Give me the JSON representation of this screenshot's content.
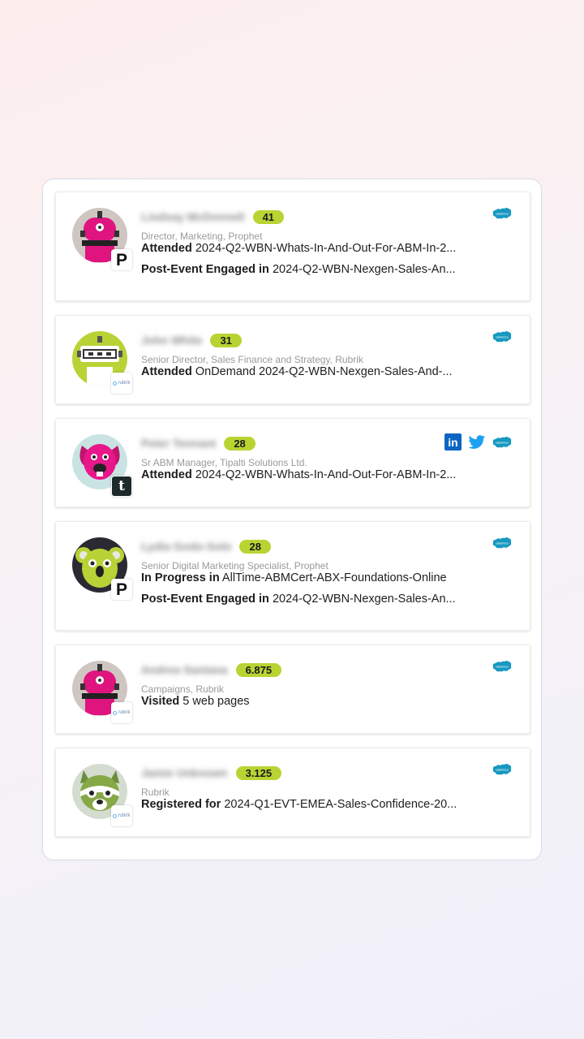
{
  "colors": {
    "score_bg": "#b8d432",
    "salesforce": "#1798c1",
    "linkedin": "#0a66c2",
    "twitter": "#1da1f2"
  },
  "contacts": [
    {
      "name": "Lindsay McDonnell",
      "score": "41",
      "title": "Director, Marketing, Prophet",
      "company_logo": "prophet-logo",
      "avatar": "pink-robot",
      "activities": [
        {
          "label": "Attended",
          "detail": " 2024-Q2-WBN-Whats-In-And-Out-For-ABM-In-2..."
        },
        {
          "label": "Post-Event Engaged in",
          "detail": " 2024-Q2-WBN-Nexgen-Sales-An..."
        }
      ],
      "icons": [
        "salesforce-icon"
      ]
    },
    {
      "name": "John White",
      "score": "31",
      "title": "Senior Director, Sales Finance and Strategy, Rubrik",
      "company_logo": "rubrik-logo",
      "avatar": "green-robot",
      "activities": [
        {
          "label": "Attended",
          "detail": " OnDemand 2024-Q2-WBN-Nexgen-Sales-And-..."
        }
      ],
      "icons": [
        "salesforce-icon"
      ]
    },
    {
      "name": "Peter Tennant",
      "score": "28",
      "title": "Sr ABM Manager, Tipalti Solutions Ltd.",
      "company_logo": "tipalti-logo",
      "avatar": "pink-dog",
      "activities": [
        {
          "label": "Attended",
          "detail": " 2024-Q2-WBN-Whats-In-And-Out-For-ABM-In-2..."
        }
      ],
      "icons": [
        "linkedin-icon",
        "twitter-icon",
        "salesforce-icon"
      ]
    },
    {
      "name": "Lydia Godo-Solo",
      "score": "28",
      "title": "Senior Digital Marketing Specialist, Prophet",
      "company_logo": "prophet-logo",
      "avatar": "green-koala",
      "activities": [
        {
          "label": "In Progress in",
          "detail": " AllTime-ABMCert-ABX-Foundations-Online"
        },
        {
          "label": "Post-Event Engaged in",
          "detail": " 2024-Q2-WBN-Nexgen-Sales-An..."
        }
      ],
      "icons": [
        "salesforce-icon"
      ]
    },
    {
      "name": "Andrea Santana",
      "score": "6.875",
      "title": "Campaigns, Rubrik",
      "company_logo": "rubrik-logo",
      "avatar": "pink-robot",
      "activities": [
        {
          "label": "Visited",
          "detail": " 5 web pages"
        }
      ],
      "icons": [
        "salesforce-icon"
      ]
    },
    {
      "name": "Jamie Unknown",
      "score": "3.125",
      "title": "Rubrik",
      "company_logo": "rubrik-logo",
      "avatar": "green-raccoon",
      "activities": [
        {
          "label": "Registered for",
          "detail": " 2024-Q1-EVT-EMEA-Sales-Confidence-20..."
        }
      ],
      "icons": [
        "salesforce-icon"
      ]
    }
  ]
}
